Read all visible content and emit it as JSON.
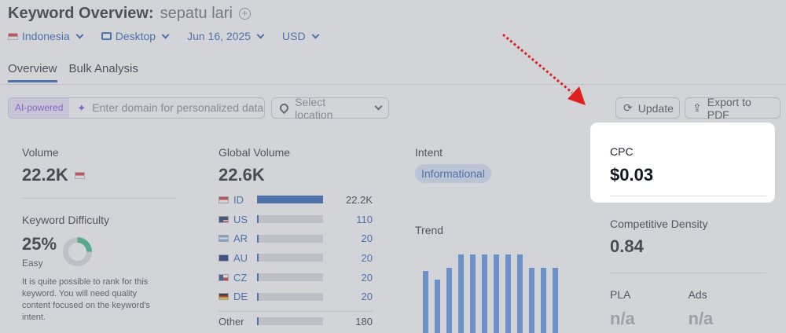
{
  "header": {
    "title": "Keyword Overview:",
    "keyword": "sepatu lari"
  },
  "filters": {
    "country": "Indonesia",
    "device": "Desktop",
    "date": "Jun 16, 2025",
    "currency": "USD"
  },
  "tabs": [
    {
      "label": "Overview",
      "active": true
    },
    {
      "label": "Bulk Analysis",
      "active": false
    }
  ],
  "toolbar": {
    "ai_label": "AI-powered",
    "domain_placeholder": "Enter domain for personalized data",
    "location_placeholder": "Select location",
    "update_label": "Update",
    "export_label": "Export to PDF"
  },
  "volume": {
    "label": "Volume",
    "value": "22.2K"
  },
  "keyword_difficulty": {
    "label": "Keyword Difficulty",
    "value": "25%",
    "level": "Easy",
    "percent": 25,
    "description": "It is quite possible to rank for this keyword. You will need quality content focused on the keyword's intent."
  },
  "global_volume": {
    "label": "Global Volume",
    "value": "22.6K",
    "rows": [
      {
        "code": "ID",
        "value": "22.2K",
        "share": 1.0
      },
      {
        "code": "US",
        "value": "110",
        "share": 0.02
      },
      {
        "code": "AR",
        "value": "20",
        "share": 0.01
      },
      {
        "code": "AU",
        "value": "20",
        "share": 0.01
      },
      {
        "code": "CZ",
        "value": "20",
        "share": 0.01
      },
      {
        "code": "DE",
        "value": "20",
        "share": 0.01
      }
    ],
    "other": {
      "label": "Other",
      "value": "180",
      "share": 0.02
    }
  },
  "intent": {
    "label": "Intent",
    "value": "Informational"
  },
  "trend": {
    "label": "Trend",
    "values": [
      0.73,
      0.63,
      0.77,
      0.93,
      0.93,
      0.93,
      0.93,
      0.93,
      0.93,
      0.77,
      0.77,
      0.77
    ]
  },
  "cpc": {
    "label": "CPC",
    "value": "$0.03"
  },
  "competitive_density": {
    "label": "Competitive Density",
    "value": "0.84"
  },
  "pla": {
    "label": "PLA",
    "value": "n/a"
  },
  "ads": {
    "label": "Ads",
    "value": "n/a"
  }
}
